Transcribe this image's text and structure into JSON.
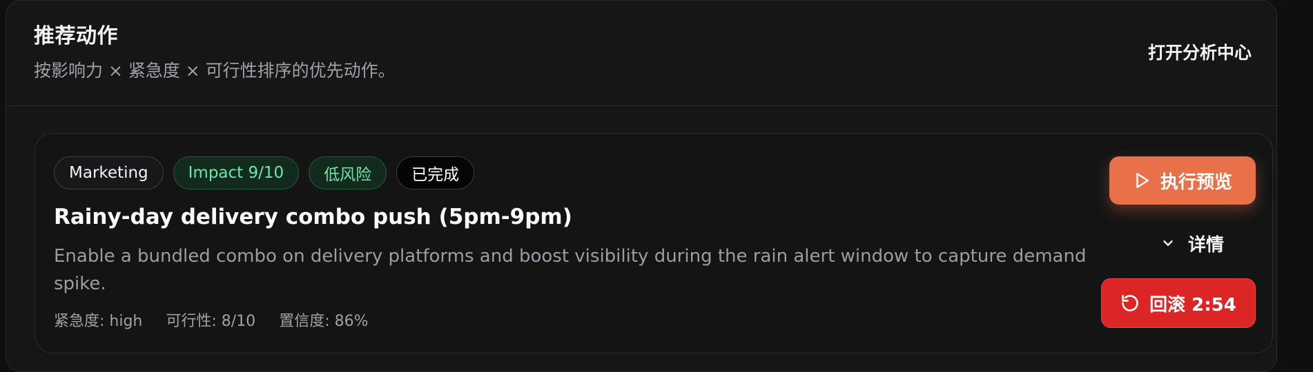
{
  "header": {
    "title": "推荐动作",
    "subtitle": "按影响力 × 紧急度 × 可行性排序的优先动作。",
    "link_label": "打开分析中心"
  },
  "action": {
    "tags": {
      "category": "Marketing",
      "impact": "Impact 9/10",
      "risk": "低风险",
      "status": "已完成"
    },
    "title": "Rainy-day delivery combo push (5pm-9pm)",
    "description": "Enable a bundled combo on delivery platforms and boost visibility during the rain alert window to capture demand spike.",
    "meta": {
      "urgency": "紧急度: high",
      "feasibility": "可行性: 8/10",
      "confidence": "置信度: 86%"
    },
    "buttons": {
      "run_label": "执行预览",
      "details_label": "详情",
      "rollback_label": "回滚 2:54"
    },
    "icons": {
      "run": "play-icon",
      "details": "chevron-down-icon",
      "rollback": "rotate-ccw-icon"
    }
  },
  "colors": {
    "accent_orange": "#e8714a",
    "danger_red": "#dc2626",
    "success_green": "#6ee7a8",
    "background": "#161617"
  }
}
